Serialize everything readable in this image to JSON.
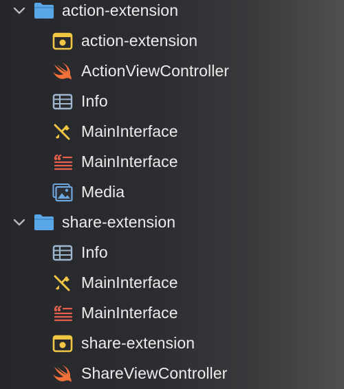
{
  "navigator": {
    "groups": [
      {
        "name": "action-extension",
        "icon": "folder-icon",
        "expanded": true,
        "files": [
          {
            "name": "action-extension",
            "icon": "entitlements-icon"
          },
          {
            "name": "ActionViewController",
            "icon": "swift-icon"
          },
          {
            "name": "Info",
            "icon": "plist-icon"
          },
          {
            "name": "MainInterface",
            "icon": "storyboard-icon"
          },
          {
            "name": "MainInterface",
            "icon": "strings-icon"
          },
          {
            "name": "Media",
            "icon": "asset-catalog-icon"
          }
        ]
      },
      {
        "name": "share-extension",
        "icon": "folder-icon",
        "expanded": true,
        "files": [
          {
            "name": "Info",
            "icon": "plist-icon"
          },
          {
            "name": "MainInterface",
            "icon": "storyboard-icon"
          },
          {
            "name": "MainInterface",
            "icon": "strings-icon"
          },
          {
            "name": "share-extension",
            "icon": "entitlements-icon"
          },
          {
            "name": "ShareViewController",
            "icon": "swift-icon"
          }
        ]
      }
    ]
  },
  "colors": {
    "folder": "#5aa7e8",
    "swift": "#f0703a",
    "entitlements": "#f2c744",
    "plist": "#9fb7cf",
    "storyboard": "#f2c744",
    "strings": "#e8604c",
    "asset": "#6ea8e0",
    "chevron": "#b8b8bb",
    "text": "#ececec"
  }
}
